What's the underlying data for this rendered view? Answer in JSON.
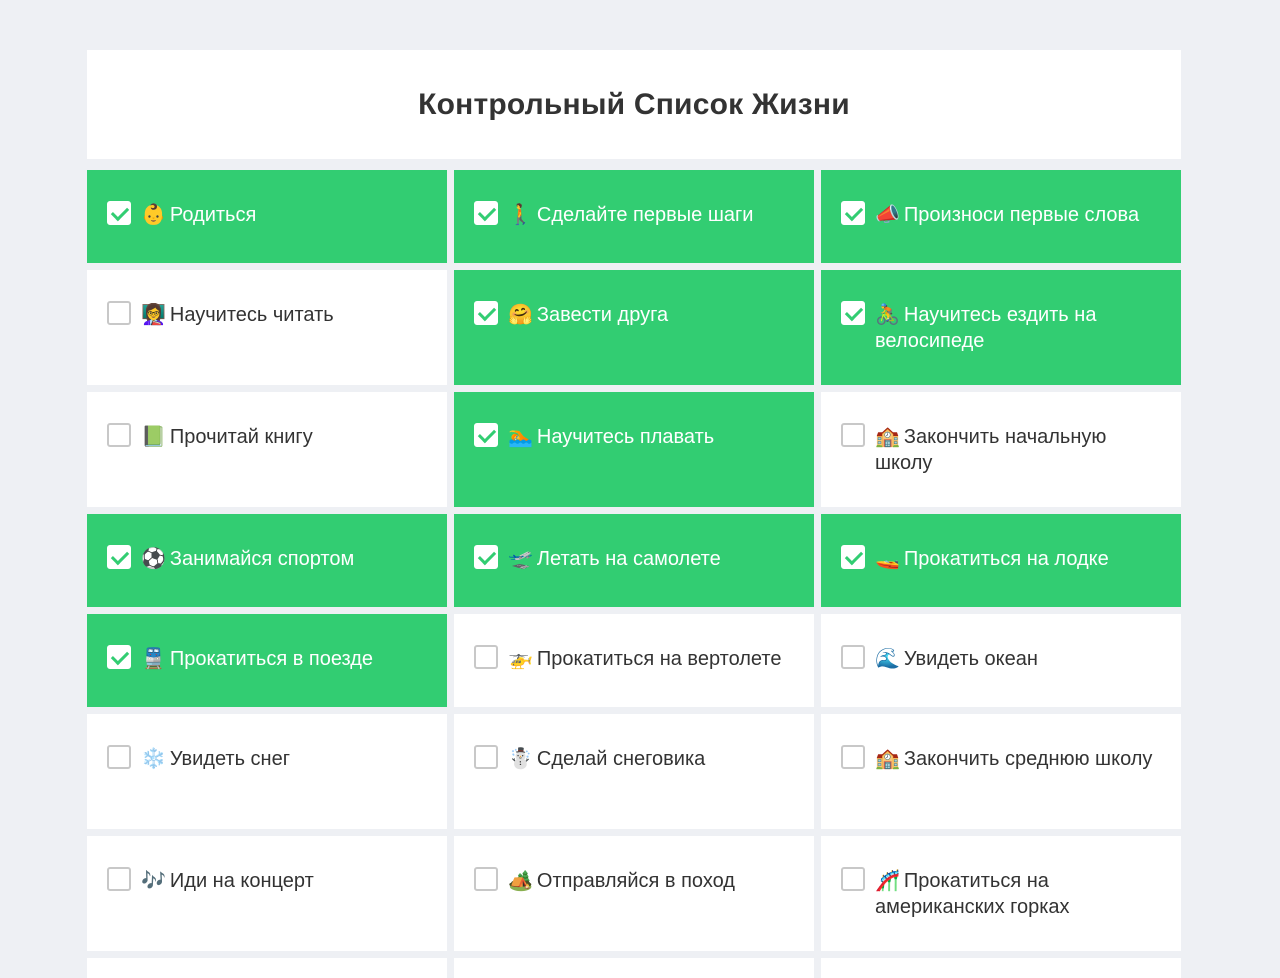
{
  "title": "Контрольный Список Жизни",
  "colors": {
    "done": "#32cd72",
    "pending": "#ffffff",
    "page": "#eef0f4"
  },
  "items": [
    {
      "emoji": "👶",
      "label": "Родиться",
      "done": true
    },
    {
      "emoji": "🚶",
      "label": "Сделайте первые шаги",
      "done": true
    },
    {
      "emoji": "📣",
      "label": "Произноси первые слова",
      "done": true
    },
    {
      "emoji": "👩‍🏫",
      "label": "Научитесь читать",
      "done": false
    },
    {
      "emoji": "🤗",
      "label": "Завести друга",
      "done": true
    },
    {
      "emoji": "🚴",
      "label": "Научитесь ездить на велосипеде",
      "done": true
    },
    {
      "emoji": "📗",
      "label": "Прочитай книгу",
      "done": false
    },
    {
      "emoji": "🏊",
      "label": "Научитесь плавать",
      "done": true
    },
    {
      "emoji": "🏫",
      "label": "Закончить начальную школу",
      "done": false
    },
    {
      "emoji": "⚽",
      "label": "Занимайся спортом",
      "done": true
    },
    {
      "emoji": "🛫",
      "label": "Летать на самолете",
      "done": true
    },
    {
      "emoji": "🚤",
      "label": "Прокатиться на лодке",
      "done": true
    },
    {
      "emoji": "🚆",
      "label": "Прокатиться в поезде",
      "done": true
    },
    {
      "emoji": "🚁",
      "label": "Прокатиться на вертолете",
      "done": false
    },
    {
      "emoji": "🌊",
      "label": "Увидеть океан",
      "done": false
    },
    {
      "emoji": "❄️",
      "label": "Увидеть снег",
      "done": false
    },
    {
      "emoji": "☃️",
      "label": "Сделай снеговика",
      "done": false
    },
    {
      "emoji": "🏫",
      "label": "Закончить среднюю школу",
      "done": false
    },
    {
      "emoji": "🎶",
      "label": "Иди на концерт",
      "done": false
    },
    {
      "emoji": "🏕️",
      "label": "Отправляйся в поход",
      "done": false
    },
    {
      "emoji": "🎢",
      "label": "Прокатиться на американских горках",
      "done": false
    }
  ]
}
